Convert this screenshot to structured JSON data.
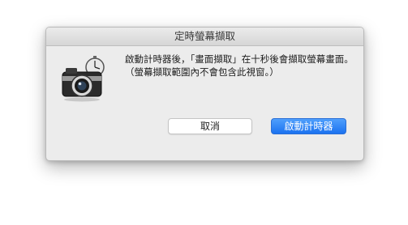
{
  "window": {
    "title": "定時螢幕擷取"
  },
  "dialog": {
    "icon": "camera-timer-icon",
    "message": "啟動計時器後，「畫面擷取」在十秒後會擷取螢幕畫面。（螢幕擷取範圍內不會包含此視窗。）"
  },
  "buttons": {
    "cancel_label": "取消",
    "start_label": "啟動計時器"
  },
  "colors": {
    "accent": "#1b72f0",
    "window_bg": "#ececec"
  }
}
